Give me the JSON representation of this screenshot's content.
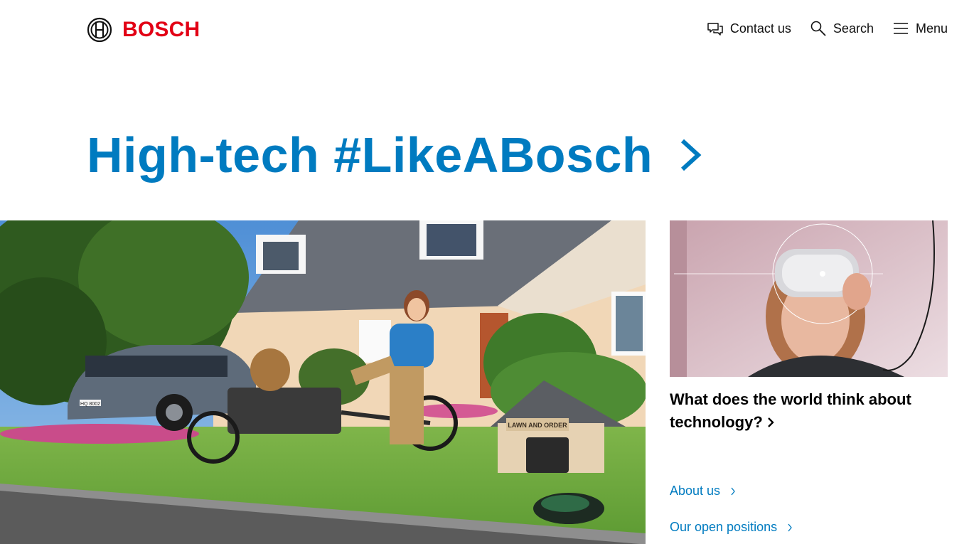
{
  "header": {
    "brand": "BOSCH",
    "nav": [
      {
        "label": "Contact us",
        "icon": "chat-icon"
      },
      {
        "label": "Search",
        "icon": "search-icon"
      },
      {
        "label": "Menu",
        "icon": "hamburger-icon"
      }
    ]
  },
  "hero": {
    "headline": "High-tech #LikeABosch"
  },
  "main_image": {
    "doghouse_sign": "LAWN AND ORDER",
    "license_plate": "HQ 8002"
  },
  "teaser": {
    "title": "What does the world think about technology?"
  },
  "links": [
    {
      "label": "About us"
    },
    {
      "label": "Our open positions"
    }
  ],
  "colors": {
    "brand_red": "#e20015",
    "accent_blue": "#007bc0"
  }
}
